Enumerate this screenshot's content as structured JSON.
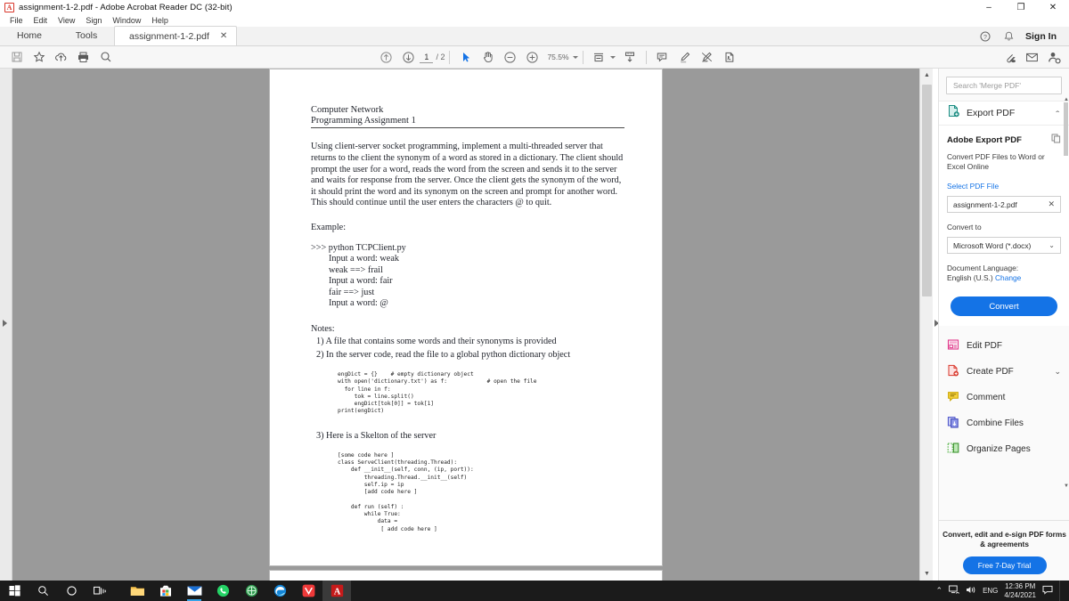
{
  "window": {
    "title": "assignment-1-2.pdf - Adobe Acrobat Reader DC (32-bit)",
    "app_icon": "acrobat-icon",
    "minimize": "–",
    "maximize": "❐",
    "close": "✕"
  },
  "menubar": {
    "items": [
      "File",
      "Edit",
      "View",
      "Sign",
      "Window",
      "Help"
    ]
  },
  "tabs": {
    "home": "Home",
    "tools": "Tools",
    "document": "assignment-1-2.pdf",
    "close_glyph": "✕"
  },
  "account": {
    "help_icon": "?",
    "bell_icon": "🔔",
    "sign_in": "Sign In"
  },
  "toolbar": {
    "save_icon": "save-icon",
    "star_icon": "star-icon",
    "upload_cloud_icon": "upload-cloud-icon",
    "print_icon": "print-icon",
    "search_icon": "search-icon",
    "prev_page_icon": "page-up-icon",
    "next_page_icon": "page-down-icon",
    "page_current": "1",
    "page_total": "/ 2",
    "select_tool_icon": "select-cursor-icon",
    "hand_tool_icon": "hand-icon",
    "zoom_out_icon": "zoom-out-icon",
    "zoom_in_icon": "zoom-in-icon",
    "zoom_level": "75.5%",
    "fit_page_icon": "fit-page-icon",
    "scroll_mode_icon": "scroll-mode-icon",
    "comment_icon": "comment-icon",
    "highlight_icon": "highlight-icon",
    "draw_icon": "draw-icon",
    "sign_icon": "sign-icon",
    "attach_icon": "attach-cloud-icon",
    "email_icon": "email-icon",
    "share_icon": "share-person-icon"
  },
  "document": {
    "heading_line1": "Computer Network",
    "heading_line2": "Programming Assignment 1",
    "paragraph": "Using client-server socket programming, implement a multi-threaded server that returns to the client the synonym of a word as stored in a dictionary. The client should prompt the user for a word, reads the word from the screen and sends it to the server and waits for response from the server. Once the client gets the synonym of the word, it should print the word and its synonym on the screen and prompt for another word. This should continue until the user enters the characters @ to quit.",
    "example_label": "Example:",
    "example_prompt": ">>> python TCPClient.py",
    "example_lines": [
      "Input a word: weak",
      "weak ==> frail",
      "Input a word: fair",
      "fair ==> just",
      "Input a word: @"
    ],
    "notes_label": "Notes:",
    "note1": "1)  A file that contains some words and their synonyms is provided",
    "note2": "2)  In the server code, read the file to a global python dictionary object",
    "code1": "engDict = {}    # empty dictionary object\nwith open('dictionary.txt') as f:            # open the file\n  for line in f:\n     tok = line.split()\n     engDict[tok[0]] = tok[1]\nprint(engDict)",
    "note3": "3)  Here is a Skelton of the server",
    "code2": "[some code here ]\nclass ServeClient(threading.Thread):\n    def __init__(self, conn, (ip, port)):\n        threading.Thread.__init__(self)\n        self.ip = ip\n        [add code here ]\n\n    def run (self) :\n        while True:\n            data =\n             [ add code here ]"
  },
  "right_panel": {
    "search_placeholder": "Search 'Merge PDF'",
    "export_pdf_label": "Export PDF",
    "export_pdf_icon": "export-pdf-icon",
    "export_chevron": "⌃",
    "card_title": "Adobe Export PDF",
    "card_copy_icon": "copy-icon",
    "card_desc": "Convert PDF Files to Word or Excel Online",
    "select_file_link": "Select PDF File",
    "selected_file": "assignment-1-2.pdf",
    "clear_file_glyph": "✕",
    "convert_to_label": "Convert to",
    "convert_format": "Microsoft Word (*.docx)",
    "format_chevron": "⌄",
    "doc_language_label": "Document Language:",
    "doc_language_value": "English (U.S.)",
    "doc_language_change": "Change",
    "convert_button": "Convert",
    "tools": [
      {
        "label": "Edit PDF",
        "icon": "edit-pdf-icon",
        "chevron": ""
      },
      {
        "label": "Create PDF",
        "icon": "create-pdf-icon",
        "chevron": "⌄"
      },
      {
        "label": "Comment",
        "icon": "comment-tool-icon",
        "chevron": ""
      },
      {
        "label": "Combine Files",
        "icon": "combine-files-icon",
        "chevron": ""
      },
      {
        "label": "Organize Pages",
        "icon": "organize-pages-icon",
        "chevron": ""
      }
    ],
    "promo_text": "Convert, edit and e-sign PDF forms & agreements",
    "promo_button": "Free 7-Day Trial"
  },
  "taskbar": {
    "start_icon": "windows-start-icon",
    "search_icon": "taskbar-search-icon",
    "cortana_icon": "cortana-icon",
    "taskview_icon": "task-view-icon",
    "apps": [
      {
        "name": "file-explorer-icon"
      },
      {
        "name": "microsoft-store-icon"
      },
      {
        "name": "mail-icon"
      },
      {
        "name": "whatsapp-icon"
      },
      {
        "name": "browser-globe-icon"
      },
      {
        "name": "edge-icon"
      },
      {
        "name": "vivaldi-icon"
      },
      {
        "name": "acrobat-reader-icon"
      }
    ],
    "tray_chevron": "⌃",
    "network_icon": "network-icon",
    "volume_icon": "volume-icon",
    "language": "ENG",
    "time": "12:36 PM",
    "date": "4/24/2021",
    "notifications_icon": "notifications-icon"
  },
  "colors": {
    "accent_blue": "#1473e6",
    "doc_bg": "#9a9a9a",
    "panel_bg": "#fafafa",
    "taskbar": "#1b1b1b"
  }
}
